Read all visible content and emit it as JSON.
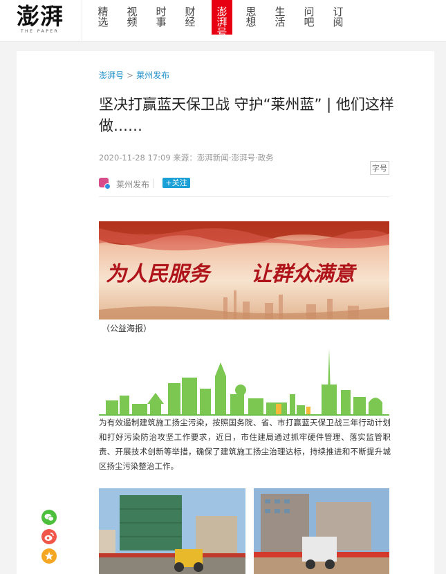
{
  "header": {
    "logo_text": "澎湃",
    "logo_sub": "THE PAPER",
    "nav": [
      "精选",
      "视频",
      "时事",
      "财经",
      "澎湃号",
      "思想",
      "生活",
      "问吧",
      "订阅"
    ],
    "active_nav": "澎湃号"
  },
  "article": {
    "breadcrumb": [
      "澎湃号",
      "莱州发布"
    ],
    "title": "坚决打赢蓝天保卫战 守护“莱州蓝” | 他们这样做……",
    "meta": "2020-11-28 17:09 来源：澎湃新闻·澎湃号·政务",
    "font_button": "字号",
    "author": "莱州发布",
    "follow_label": "+关注",
    "banner_slogan": "为人民服务 让群众满意",
    "banner_caption": "（公益海报）",
    "paragraph": "为有效遏制建筑施工扬尘污染，按照国务院、省、市打赢蓝天保卫战三年行动计划和打好污染防治攻坚工作要求，近日，市住建局通过抓牢硬件管理、落实监管职责、开展技术创新等举措，确保了建筑施工扬尘治理达标，持续推进和不断提升城区扬尘污染整治工作。"
  },
  "share": [
    "wechat-icon",
    "weibo-icon",
    "favorite-icon"
  ],
  "colors": {
    "accent_red": "#e60012",
    "link_blue": "#1a8ec8",
    "follow_blue": "#1a9fd6",
    "skyline_green": "#6cc04a"
  }
}
